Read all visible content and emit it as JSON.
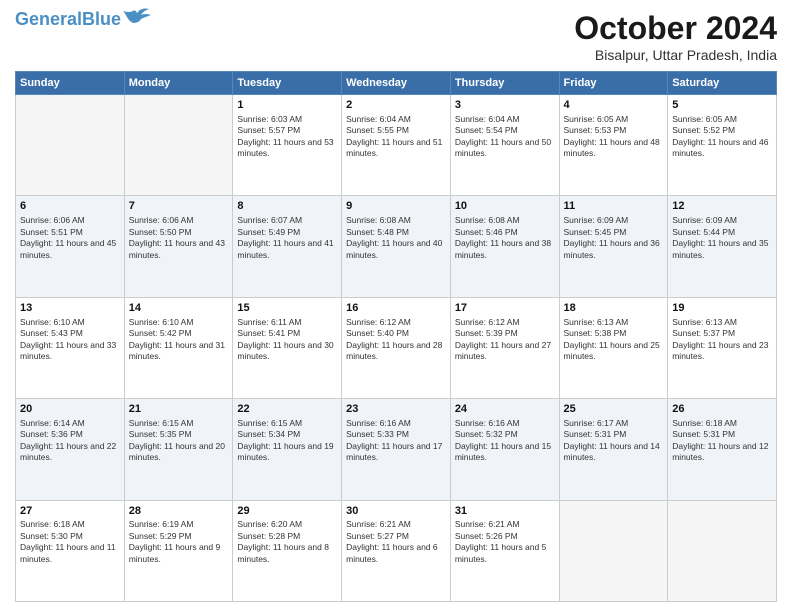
{
  "logo": {
    "line1": "General",
    "line2": "Blue"
  },
  "title": "October 2024",
  "location": "Bisalpur, Uttar Pradesh, India",
  "days_of_week": [
    "Sunday",
    "Monday",
    "Tuesday",
    "Wednesday",
    "Thursday",
    "Friday",
    "Saturday"
  ],
  "weeks": [
    [
      {
        "day": "",
        "empty": true
      },
      {
        "day": "",
        "empty": true
      },
      {
        "day": "1",
        "sunrise": "6:03 AM",
        "sunset": "5:57 PM",
        "daylight": "11 hours and 53 minutes."
      },
      {
        "day": "2",
        "sunrise": "6:04 AM",
        "sunset": "5:55 PM",
        "daylight": "11 hours and 51 minutes."
      },
      {
        "day": "3",
        "sunrise": "6:04 AM",
        "sunset": "5:54 PM",
        "daylight": "11 hours and 50 minutes."
      },
      {
        "day": "4",
        "sunrise": "6:05 AM",
        "sunset": "5:53 PM",
        "daylight": "11 hours and 48 minutes."
      },
      {
        "day": "5",
        "sunrise": "6:05 AM",
        "sunset": "5:52 PM",
        "daylight": "11 hours and 46 minutes."
      }
    ],
    [
      {
        "day": "6",
        "sunrise": "6:06 AM",
        "sunset": "5:51 PM",
        "daylight": "11 hours and 45 minutes."
      },
      {
        "day": "7",
        "sunrise": "6:06 AM",
        "sunset": "5:50 PM",
        "daylight": "11 hours and 43 minutes."
      },
      {
        "day": "8",
        "sunrise": "6:07 AM",
        "sunset": "5:49 PM",
        "daylight": "11 hours and 41 minutes."
      },
      {
        "day": "9",
        "sunrise": "6:08 AM",
        "sunset": "5:48 PM",
        "daylight": "11 hours and 40 minutes."
      },
      {
        "day": "10",
        "sunrise": "6:08 AM",
        "sunset": "5:46 PM",
        "daylight": "11 hours and 38 minutes."
      },
      {
        "day": "11",
        "sunrise": "6:09 AM",
        "sunset": "5:45 PM",
        "daylight": "11 hours and 36 minutes."
      },
      {
        "day": "12",
        "sunrise": "6:09 AM",
        "sunset": "5:44 PM",
        "daylight": "11 hours and 35 minutes."
      }
    ],
    [
      {
        "day": "13",
        "sunrise": "6:10 AM",
        "sunset": "5:43 PM",
        "daylight": "11 hours and 33 minutes."
      },
      {
        "day": "14",
        "sunrise": "6:10 AM",
        "sunset": "5:42 PM",
        "daylight": "11 hours and 31 minutes."
      },
      {
        "day": "15",
        "sunrise": "6:11 AM",
        "sunset": "5:41 PM",
        "daylight": "11 hours and 30 minutes."
      },
      {
        "day": "16",
        "sunrise": "6:12 AM",
        "sunset": "5:40 PM",
        "daylight": "11 hours and 28 minutes."
      },
      {
        "day": "17",
        "sunrise": "6:12 AM",
        "sunset": "5:39 PM",
        "daylight": "11 hours and 27 minutes."
      },
      {
        "day": "18",
        "sunrise": "6:13 AM",
        "sunset": "5:38 PM",
        "daylight": "11 hours and 25 minutes."
      },
      {
        "day": "19",
        "sunrise": "6:13 AM",
        "sunset": "5:37 PM",
        "daylight": "11 hours and 23 minutes."
      }
    ],
    [
      {
        "day": "20",
        "sunrise": "6:14 AM",
        "sunset": "5:36 PM",
        "daylight": "11 hours and 22 minutes."
      },
      {
        "day": "21",
        "sunrise": "6:15 AM",
        "sunset": "5:35 PM",
        "daylight": "11 hours and 20 minutes."
      },
      {
        "day": "22",
        "sunrise": "6:15 AM",
        "sunset": "5:34 PM",
        "daylight": "11 hours and 19 minutes."
      },
      {
        "day": "23",
        "sunrise": "6:16 AM",
        "sunset": "5:33 PM",
        "daylight": "11 hours and 17 minutes."
      },
      {
        "day": "24",
        "sunrise": "6:16 AM",
        "sunset": "5:32 PM",
        "daylight": "11 hours and 15 minutes."
      },
      {
        "day": "25",
        "sunrise": "6:17 AM",
        "sunset": "5:31 PM",
        "daylight": "11 hours and 14 minutes."
      },
      {
        "day": "26",
        "sunrise": "6:18 AM",
        "sunset": "5:31 PM",
        "daylight": "11 hours and 12 minutes."
      }
    ],
    [
      {
        "day": "27",
        "sunrise": "6:18 AM",
        "sunset": "5:30 PM",
        "daylight": "11 hours and 11 minutes."
      },
      {
        "day": "28",
        "sunrise": "6:19 AM",
        "sunset": "5:29 PM",
        "daylight": "11 hours and 9 minutes."
      },
      {
        "day": "29",
        "sunrise": "6:20 AM",
        "sunset": "5:28 PM",
        "daylight": "11 hours and 8 minutes."
      },
      {
        "day": "30",
        "sunrise": "6:21 AM",
        "sunset": "5:27 PM",
        "daylight": "11 hours and 6 minutes."
      },
      {
        "day": "31",
        "sunrise": "6:21 AM",
        "sunset": "5:26 PM",
        "daylight": "11 hours and 5 minutes."
      },
      {
        "day": "",
        "empty": true
      },
      {
        "day": "",
        "empty": true
      }
    ]
  ]
}
